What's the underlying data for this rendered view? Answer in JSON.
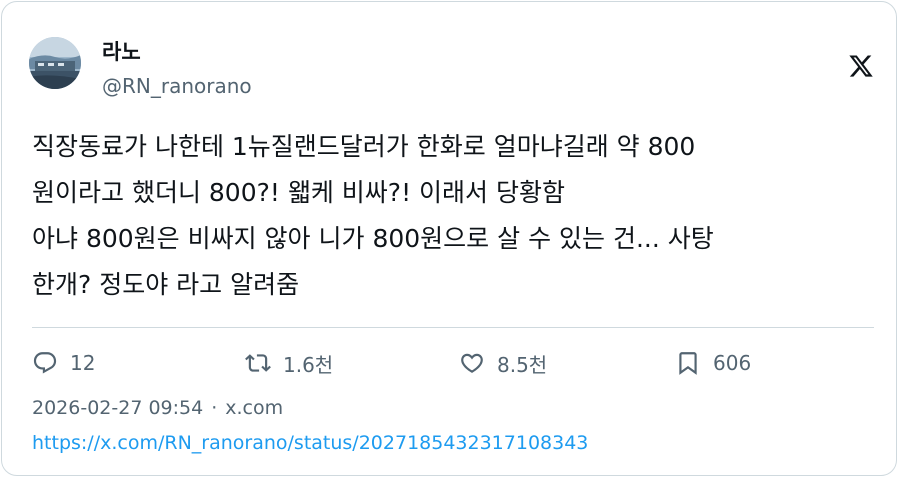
{
  "author": {
    "display_name": "라노",
    "handle": "@RN_ranorano",
    "avatar_icon": "avatar-photo"
  },
  "platform_icon": "x-logo-icon",
  "tweet": {
    "lines": [
      "직장동료가 나한테 1뉴질랜드달러가 한화로 얼마냐길래 약 800",
      "원이라고 했더니 800?! 왧케 비싸?! 이래서 당황함",
      "아냐 800원은 비싸지 않아 니가 800원으로 살 수 있는 건... 사탕",
      "한개? 정도야 라고 알려줌"
    ]
  },
  "actions": {
    "reply": {
      "icon": "reply-icon",
      "count": "12"
    },
    "retweet": {
      "icon": "retweet-icon",
      "count": "1.6천"
    },
    "like": {
      "icon": "heart-icon",
      "count": "8.5천"
    },
    "bookmark": {
      "icon": "bookmark-icon",
      "count": "606"
    }
  },
  "meta": {
    "timestamp": "2026-02-27 09:54",
    "separator": "·",
    "source": "x.com"
  },
  "link": "https://x.com/RN_ranorano/status/2027185432317108343",
  "colors": {
    "text": "#0f1419",
    "secondary": "#536471",
    "link": "#1d9bf0",
    "border": "#cfd9de"
  }
}
